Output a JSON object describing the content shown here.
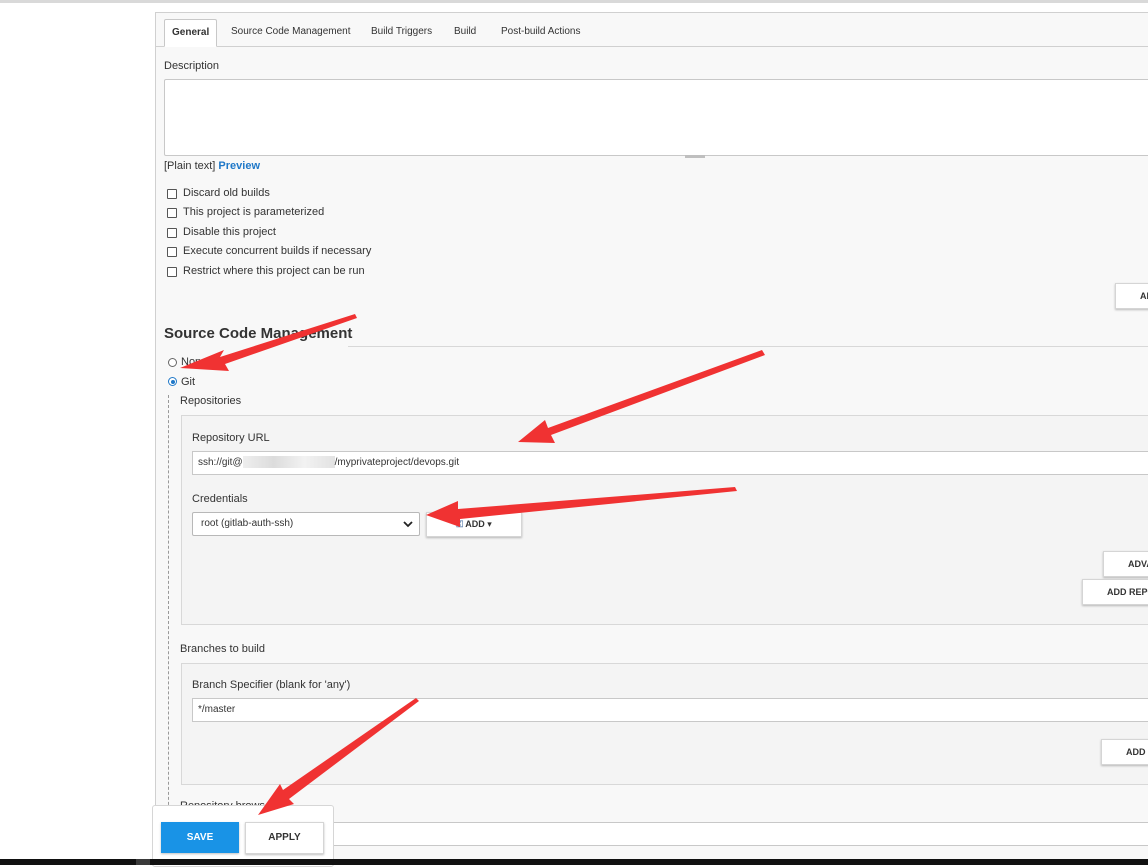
{
  "tabs": [
    "General",
    "Source Code Management",
    "Build Triggers",
    "Build",
    "Post-build Actions"
  ],
  "general": {
    "description_label": "Description",
    "description_value": "",
    "plain_text": "[Plain text]",
    "preview_link": "Preview",
    "options": [
      "Discard old builds",
      "This project is parameterized",
      "Disable this project",
      "Execute concurrent builds if necessary",
      "Restrict where this project can be run"
    ],
    "advanced_button": "AD"
  },
  "scm": {
    "title": "Source Code Management",
    "none_label": "None",
    "git_label": "Git",
    "selected": "Git",
    "repositories_label": "Repositories",
    "repo_url_label": "Repository URL",
    "repo_url_prefix": "ssh://git@",
    "repo_url_suffix": "/myprivateproject/devops.git",
    "credentials_label": "Credentials",
    "credentials_value": "root (gitlab-auth-ssh)",
    "add_button": "ADD",
    "advanced_button": "ADVA",
    "add_repository_button": "ADD REPO",
    "branches_label": "Branches to build",
    "branch_spec_label": "Branch Specifier (blank for 'any')",
    "branch_spec_value": "*/master",
    "add_branch_button": "ADD I",
    "repo_browser_label": "Repository browser"
  },
  "footer": {
    "save_button": "SAVE",
    "apply_button": "APPLY"
  },
  "colors": {
    "accent": "#1993e6",
    "link": "#1f78c8",
    "annotation_arrow": "#f03232"
  },
  "icons": {
    "add": "key-icon",
    "dropdown": "chevron-down-icon"
  }
}
